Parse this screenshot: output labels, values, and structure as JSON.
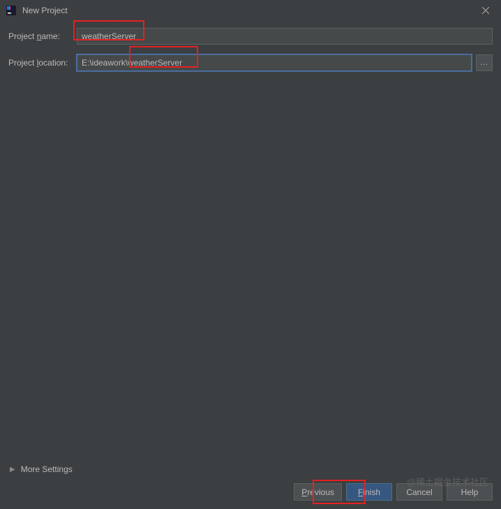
{
  "window": {
    "title": "New Project"
  },
  "form": {
    "projectName": {
      "label_pre": "Project ",
      "label_mn": "n",
      "label_post": "ame:",
      "value": "weatherServer"
    },
    "projectLocation": {
      "label_pre": "Project ",
      "label_mn": "l",
      "label_post": "ocation:",
      "value": "E:\\ideawork\\weatherServer",
      "browse": "..."
    }
  },
  "moreSettings": {
    "label": "More Settings"
  },
  "buttons": {
    "previous_mn": "P",
    "previous_rest": "revious",
    "finish_mn": "F",
    "finish_rest": "inish",
    "cancel": "Cancel",
    "help": "Help"
  },
  "watermark": "@稀土掘金技术社区"
}
